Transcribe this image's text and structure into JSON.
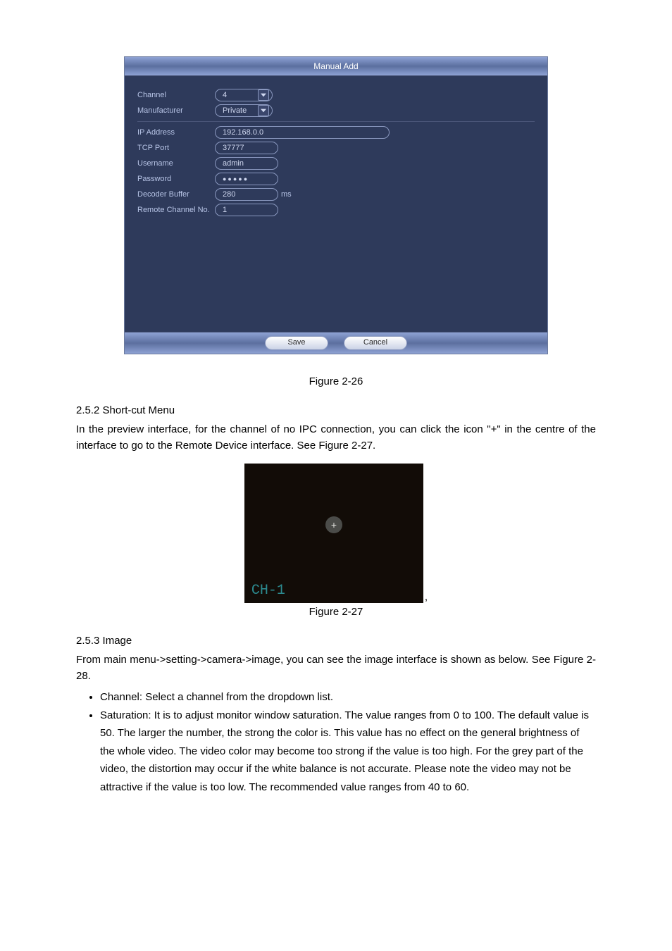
{
  "dialog": {
    "title": "Manual Add",
    "channel_label": "Channel",
    "channel_value": "4",
    "manufacturer_label": "Manufacturer",
    "manufacturer_value": "Private",
    "ip_label": "IP Address",
    "ip_value": "192.168.0.0",
    "tcp_label": "TCP Port",
    "tcp_value": "37777",
    "user_label": "Username",
    "user_value": "admin",
    "pwd_label": "Password",
    "pwd_value": "●●●●●",
    "decbuf_label": "Decoder Buffer",
    "decbuf_value": "280",
    "decbuf_unit": "ms",
    "remote_label": "Remote Channel No.",
    "remote_value": "1",
    "save_btn": "Save",
    "cancel_btn": "Cancel"
  },
  "caption1": "Figure 2-26",
  "shortcut_heading": "2.5.2 Short-cut Menu",
  "shortcut_text": "In the preview interface, for the channel of no IPC connection, you can click the icon \"+\" in the centre of the interface to go to the Remote Device interface. See Figure 2-27.",
  "preview": {
    "plus": "+",
    "ch": "CH-1"
  },
  "caption2": "Figure 2-27",
  "image_heading": "2.5.3 Image",
  "image_text": "From main menu->setting->camera->image, you can see the image interface is shown as below. See Figure 2-28.",
  "bullets": [
    "Channel: Select a channel from the dropdown list.",
    "Saturation: It is to adjust monitor window saturation. The value ranges from 0 to 100. The default value is 50. The larger the number, the strong the color is. This value has no effect on the general brightness of the whole video. The video color may become too strong if the value is too high. For the grey part of the video, the distortion may occur if the white balance is not accurate. Please note the video may not be attractive if the value is too low. The recommended value ranges from 40 to 60."
  ]
}
